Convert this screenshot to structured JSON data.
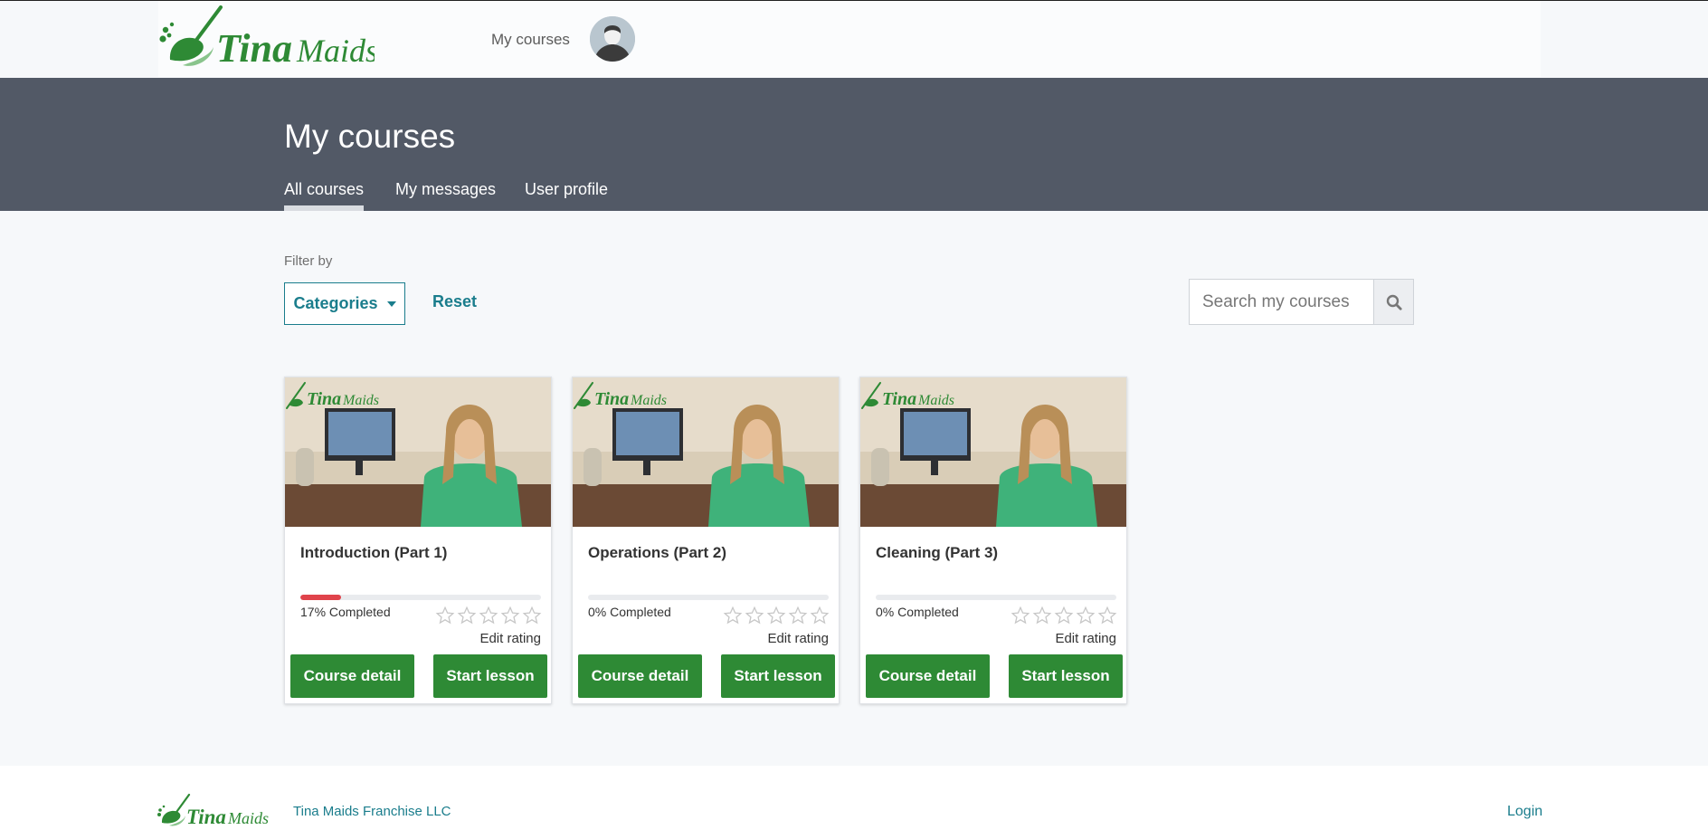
{
  "brand": {
    "name_part1": "Tina",
    "name_part2": "Maids",
    "accent": "#2e8a35",
    "link": "#1a7d8c"
  },
  "header": {
    "nav_my_courses": "My courses"
  },
  "hero": {
    "title": "My courses",
    "tabs": [
      {
        "label": "All courses",
        "active": true
      },
      {
        "label": "My messages",
        "active": false
      },
      {
        "label": "User profile",
        "active": false
      }
    ]
  },
  "filter": {
    "label": "Filter by",
    "categories_label": "Categories",
    "reset_label": "Reset",
    "search_placeholder": "Search my courses"
  },
  "courses": [
    {
      "title": "Introduction (Part 1)",
      "progress": 17,
      "progress_text": "17% Completed",
      "rating_label": "Edit rating",
      "detail_label": "Course detail",
      "start_label": "Start lesson"
    },
    {
      "title": "Operations (Part 2)",
      "progress": 0,
      "progress_text": "0% Completed",
      "rating_label": "Edit rating",
      "detail_label": "Course detail",
      "start_label": "Start lesson"
    },
    {
      "title": "Cleaning (Part 3)",
      "progress": 0,
      "progress_text": "0% Completed",
      "rating_label": "Edit rating",
      "detail_label": "Course detail",
      "start_label": "Start lesson"
    }
  ],
  "footer": {
    "company": "Tina Maids Franchise LLC",
    "login": "Login"
  }
}
